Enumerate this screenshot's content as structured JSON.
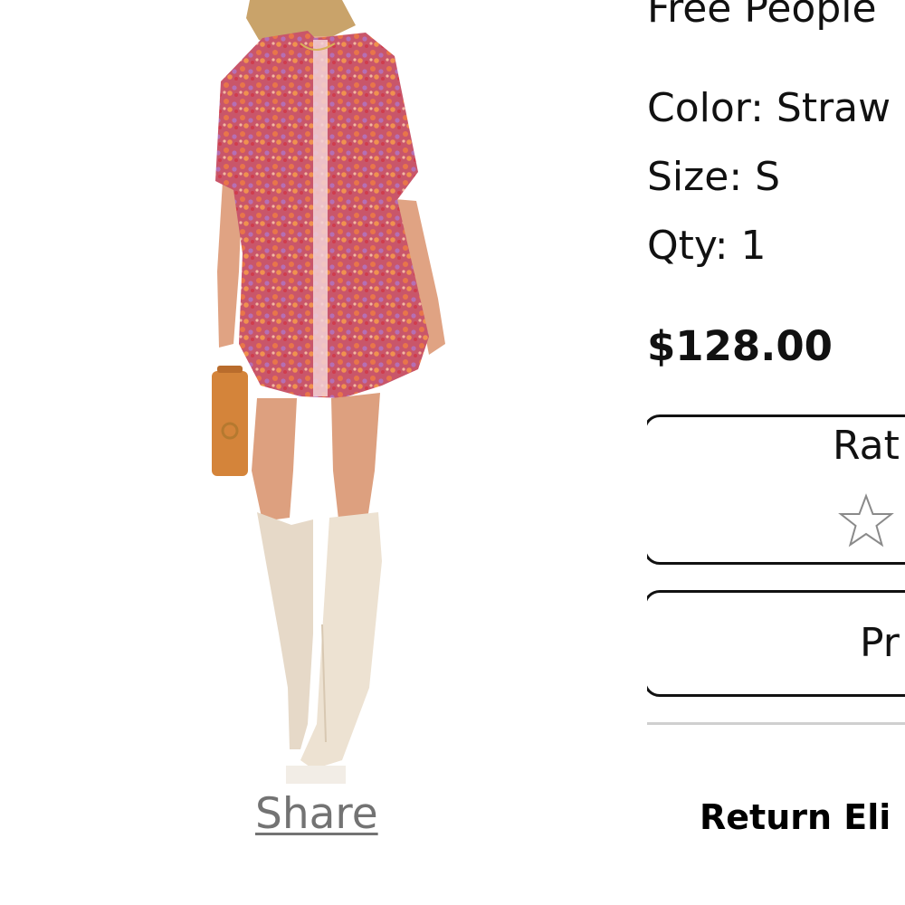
{
  "product": {
    "image_alt": "Model wearing floral mini shirt dress with tall cream boots",
    "brand": "Free People",
    "color_text": "Color: Straw",
    "size_text": "Size: S",
    "qty_text": "Qty: 1",
    "price": "$128.00"
  },
  "share": {
    "label": "Share"
  },
  "rating": {
    "label": "Rat",
    "star_icon": "star-outline-icon",
    "stars_filled": 0
  },
  "pr_button": {
    "label": "Pr"
  },
  "return": {
    "label": "Return Eli"
  },
  "colors": {
    "text": "#111111",
    "share_link": "#737373",
    "divider": "#cfcfcf",
    "star_outline": "#8a8a8a"
  }
}
